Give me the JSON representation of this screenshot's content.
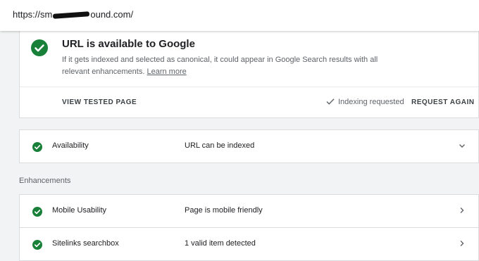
{
  "address_bar": {
    "url_prefix": "https://sm",
    "url_suffix": "ound.com/"
  },
  "status_card": {
    "title": "URL is available to Google",
    "description": "If it gets indexed and selected as canonical, it could appear in Google Search results with all relevant enhancements.",
    "learn_more": "Learn more",
    "view_tested_page": "VIEW TESTED PAGE",
    "indexing_status": "Indexing requested",
    "request_again": "REQUEST AGAIN"
  },
  "availability": {
    "label": "Availability",
    "value": "URL can be indexed"
  },
  "enhancements": {
    "title": "Enhancements",
    "items": [
      {
        "label": "Mobile Usability",
        "value": "Page is mobile friendly"
      },
      {
        "label": "Sitelinks searchbox",
        "value": "1 valid item detected"
      }
    ]
  },
  "colors": {
    "success": "#188038",
    "text": "#202124",
    "muted": "#5f6368",
    "background": "#f1f3f4"
  },
  "icons": {
    "status": "check-circle-icon",
    "row_status": "check-circle-icon",
    "indexing": "check-icon",
    "expand": "chevron-down-icon",
    "open": "chevron-right-icon"
  }
}
